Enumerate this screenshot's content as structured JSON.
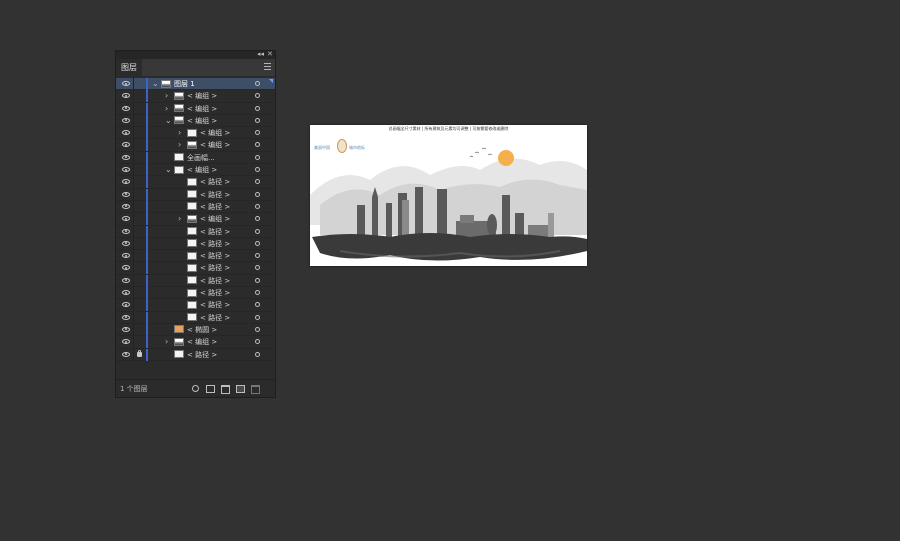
{
  "panel": {
    "tab_label": "图层",
    "top_controls": [
      "◂◂",
      "✕"
    ],
    "footer": {
      "layer_count": "1 个图层",
      "icons": [
        "search-icon",
        "clipping-mask-icon",
        "new-sublayer-icon",
        "new-layer-icon",
        "trash-icon"
      ]
    },
    "rows": [
      {
        "label": "图层 1",
        "depth": 0,
        "expand": "open",
        "thumb": "city",
        "selected": true,
        "lock": false
      },
      {
        "label": "< 编组 >",
        "depth": 1,
        "expand": "closed",
        "thumb": "city",
        "selected": false,
        "lock": false
      },
      {
        "label": "< 编组 >",
        "depth": 1,
        "expand": "closed",
        "thumb": "city",
        "selected": false,
        "lock": false
      },
      {
        "label": "< 编组 >",
        "depth": 1,
        "expand": "open",
        "thumb": "city",
        "selected": false,
        "lock": false
      },
      {
        "label": "< 编组 >",
        "depth": 2,
        "expand": "closed",
        "thumb": "white",
        "selected": false,
        "lock": false
      },
      {
        "label": "< 编组 >",
        "depth": 2,
        "expand": "closed",
        "thumb": "city",
        "selected": false,
        "lock": false
      },
      {
        "label": "全画幅...",
        "depth": 1,
        "expand": "none",
        "thumb": "white",
        "selected": false,
        "lock": false
      },
      {
        "label": "< 编组 >",
        "depth": 1,
        "expand": "open",
        "thumb": "white",
        "selected": false,
        "lock": false
      },
      {
        "label": "< 路径 >",
        "depth": 2,
        "expand": "none",
        "thumb": "white",
        "selected": false,
        "lock": false
      },
      {
        "label": "< 路径 >",
        "depth": 2,
        "expand": "none",
        "thumb": "white",
        "selected": false,
        "lock": false
      },
      {
        "label": "< 路径 >",
        "depth": 2,
        "expand": "none",
        "thumb": "white",
        "selected": false,
        "lock": false
      },
      {
        "label": "< 编组 >",
        "depth": 2,
        "expand": "closed",
        "thumb": "city",
        "selected": false,
        "lock": false
      },
      {
        "label": "< 路径 >",
        "depth": 2,
        "expand": "none",
        "thumb": "white",
        "selected": false,
        "lock": false
      },
      {
        "label": "< 路径 >",
        "depth": 2,
        "expand": "none",
        "thumb": "white",
        "selected": false,
        "lock": false
      },
      {
        "label": "< 路径 >",
        "depth": 2,
        "expand": "none",
        "thumb": "white",
        "selected": false,
        "lock": false
      },
      {
        "label": "< 路径 >",
        "depth": 2,
        "expand": "none",
        "thumb": "white",
        "selected": false,
        "lock": false
      },
      {
        "label": "< 路径 >",
        "depth": 2,
        "expand": "none",
        "thumb": "white",
        "selected": false,
        "lock": false
      },
      {
        "label": "< 路径 >",
        "depth": 2,
        "expand": "none",
        "thumb": "white",
        "selected": false,
        "lock": false
      },
      {
        "label": "< 路径 >",
        "depth": 2,
        "expand": "none",
        "thumb": "white",
        "selected": false,
        "lock": false
      },
      {
        "label": "< 路径 >",
        "depth": 2,
        "expand": "none",
        "thumb": "white",
        "selected": false,
        "lock": false
      },
      {
        "label": "< 椭圆 >",
        "depth": 1,
        "expand": "none",
        "thumb": "orange",
        "selected": false,
        "lock": false
      },
      {
        "label": "< 编组 >",
        "depth": 1,
        "expand": "closed",
        "thumb": "city",
        "selected": false,
        "lock": false
      },
      {
        "label": "< 路径 >",
        "depth": 1,
        "expand": "none",
        "thumb": "white",
        "selected": false,
        "lock": true
      }
    ]
  },
  "artboard": {
    "header_text": "总画幅全尺寸素材 | 所有建筑及元素均可调整 | 可按需要修改或删除",
    "logo_left": "美丽中国",
    "logo_right": "城市地标",
    "colors": {
      "sun": "#f4b04c",
      "ink": "#3a3a3a",
      "mist": "#d9d9d9"
    }
  }
}
